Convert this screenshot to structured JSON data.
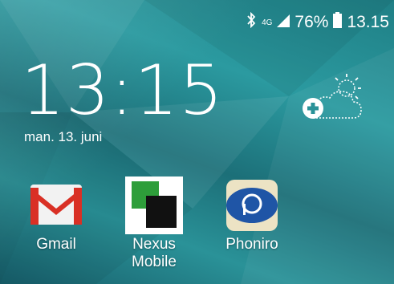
{
  "status_bar": {
    "bluetooth_icon": "bluetooth-icon",
    "network_type": "4G",
    "signal_icon": "signal-icon",
    "battery_percent": "76%",
    "battery_icon": "battery-icon",
    "time": "13.15"
  },
  "clock_widget": {
    "time": "13:15",
    "date": "man. 13. juni",
    "weather_add_icon": "weather-add-icon"
  },
  "apps": [
    {
      "label": "Gmail",
      "icon": "gmail-icon"
    },
    {
      "label": "Nexus\nMobile",
      "icon": "nexus-mobile-icon"
    },
    {
      "label": "Phoniro",
      "icon": "phoniro-icon"
    }
  ]
}
